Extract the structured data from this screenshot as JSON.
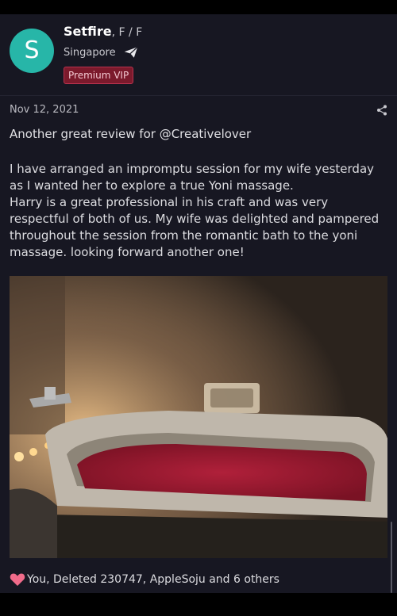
{
  "author": {
    "avatar_letter": "S",
    "name": "Setfire",
    "gender": ", F / F",
    "location": "Singapore",
    "badge": "Premium VIP"
  },
  "post": {
    "date": "Nov 12, 2021",
    "title": "Another great review for @Creativelover",
    "body": "I have arranged an impromptu session for my wife yesterday as I wanted her to explore a true Yoni massage.\nHarry is a great professional in his craft and was very respectful of both of us. My wife was delighted and pampered throughout the session from the romantic bath to the yoni massage. looking forward another one!",
    "image_alt": "Bathtub filled with rose petals lit by candles"
  },
  "reactions": {
    "text": "You, Deleted 230747, AppleSoju and 6 others"
  },
  "icons": {
    "location": "send-icon",
    "share": "share-icon",
    "like": "heart-icon"
  },
  "colors": {
    "avatar": "#27b6a8",
    "badge_bg": "#7b1a2c",
    "heart": "#f06b8a",
    "background": "#171722"
  }
}
